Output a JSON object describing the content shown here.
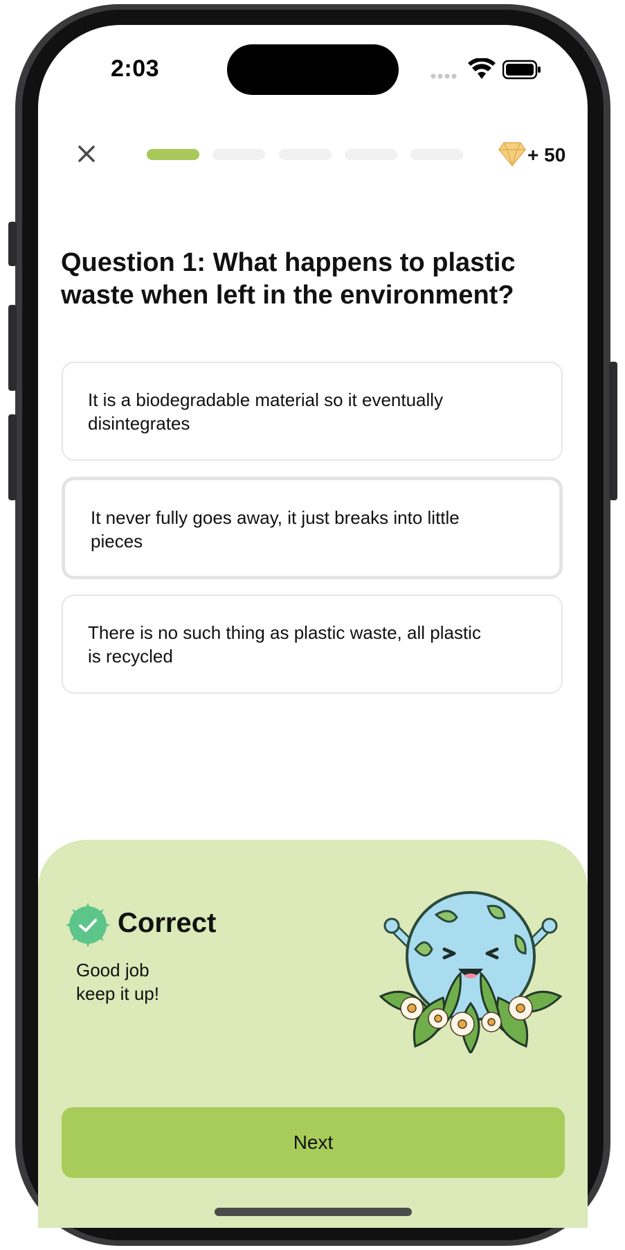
{
  "status_bar": {
    "time": "2:03"
  },
  "header": {
    "close_icon": "close-icon",
    "progress": {
      "total_steps": 5,
      "completed_steps": 1
    },
    "reward": {
      "icon": "diamond-icon",
      "label": "+ 50"
    }
  },
  "question": {
    "text": "Question 1: What happens to plastic waste when left in the environment?"
  },
  "options": [
    {
      "line1": "It is a biodegradable material so it eventually",
      "line2": "disintegrates",
      "selected": false
    },
    {
      "line1": "It never fully goes away, it just breaks into little",
      "line2": "pieces",
      "selected": true
    },
    {
      "line1": "There is no such thing as plastic waste, all plastic",
      "line2": "is recycled",
      "selected": false
    }
  ],
  "feedback": {
    "status_icon": "check-badge-icon",
    "title": "Correct",
    "message": "Good job\nkeep it up!",
    "illustration": "happy-earth-illustration"
  },
  "footer": {
    "next_label": "Next"
  },
  "colors": {
    "accent": "#a8cc5a",
    "feedback_bg": "#dce9b8",
    "check_badge": "#5dc58a"
  }
}
